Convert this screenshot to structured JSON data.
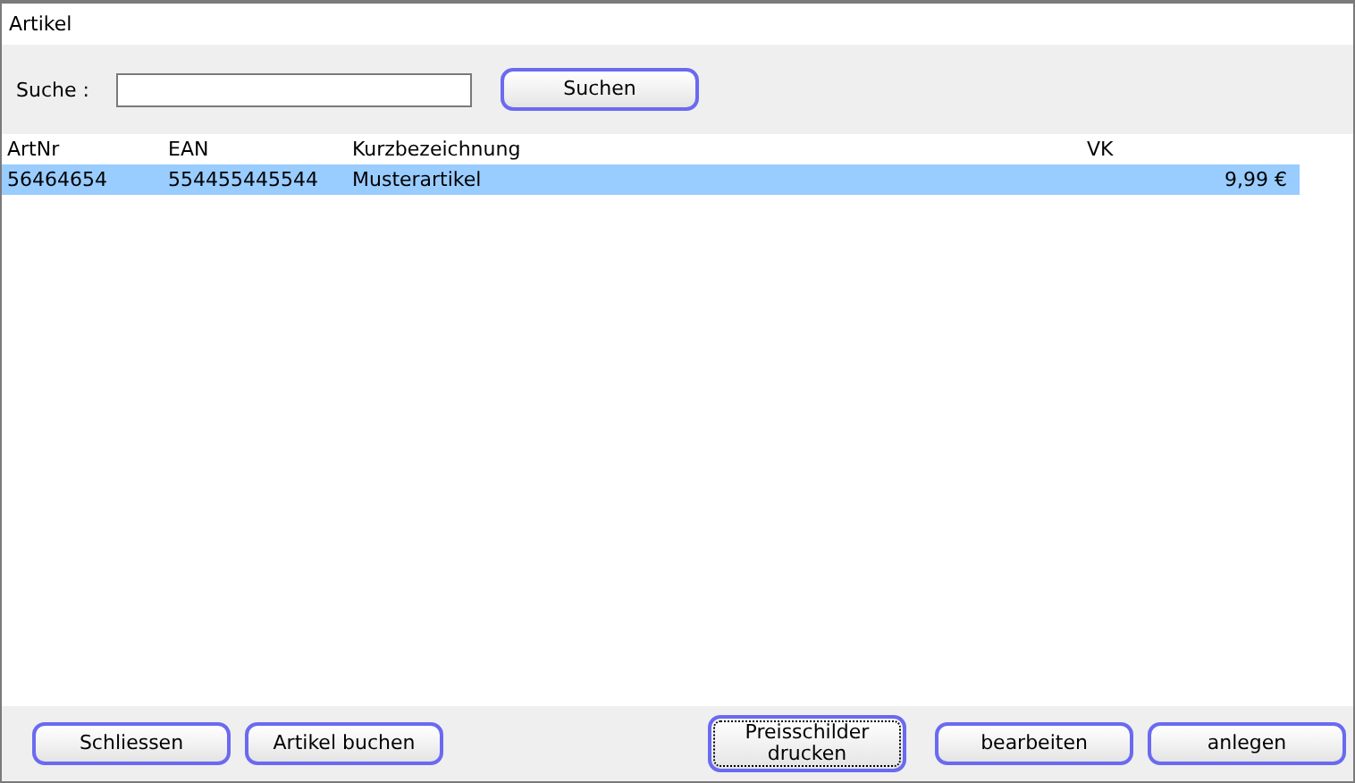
{
  "window": {
    "title": "Artikel"
  },
  "search": {
    "label": "Suche :",
    "button": "Suchen"
  },
  "table": {
    "columns": [
      "ArtNr",
      "EAN",
      "Kurzbezeichnung",
      "VK"
    ],
    "rows": [
      {
        "cells": [
          "56464654",
          "554455445544",
          "Musterartikel",
          "9,99 €"
        ],
        "selected": true
      }
    ]
  },
  "buttons": [
    {
      "label": "Schliessen",
      "focused": false
    },
    {
      "label": "Artikel buchen",
      "focused": false
    },
    {
      "label": "Preisschilder drucken",
      "focused": true
    },
    {
      "label": "bearbeiten",
      "focused": false
    },
    {
      "label": "anlegen",
      "focused": false
    }
  ]
}
